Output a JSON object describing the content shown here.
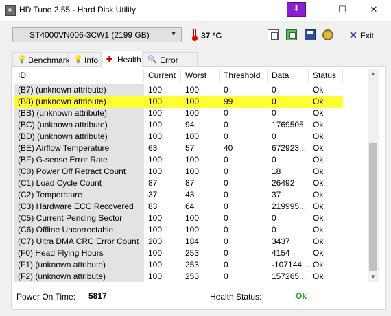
{
  "window": {
    "title": "HD Tune 2.55 - Hard Disk Utility",
    "minimize": "–",
    "maximize": "☐",
    "close": "✕"
  },
  "toolbar": {
    "drive": "ST4000VN006-3CW1 (2199 GB)",
    "temperature": "37 °C",
    "exit_label": "Exit",
    "icons": [
      "copy-icon",
      "copy-green-icon",
      "save-icon",
      "options-icon",
      "exit-icon"
    ]
  },
  "tabs": [
    {
      "label": "Benchmark",
      "icon": "benchmark-icon"
    },
    {
      "label": "Info",
      "icon": "info-icon"
    },
    {
      "label": "Health",
      "icon": "health-icon"
    },
    {
      "label": "Error Scan",
      "icon": "search-icon"
    }
  ],
  "active_tab": "Health",
  "colors": {
    "highlight": "#ffff33",
    "ok_status": "#1ea81e",
    "id_column_bg": "#e3e3e3"
  },
  "table": {
    "columns": [
      "ID",
      "Current",
      "Worst",
      "Threshold",
      "Data",
      "Status"
    ],
    "rows": [
      {
        "id": "(B7) (unknown attribute)",
        "current": "100",
        "worst": "100",
        "threshold": "0",
        "data": "0",
        "status": "Ok"
      },
      {
        "id": "(B8) (unknown attribute)",
        "current": "100",
        "worst": "100",
        "threshold": "99",
        "data": "0",
        "status": "Ok"
      },
      {
        "id": "(BB) (unknown attribute)",
        "current": "100",
        "worst": "100",
        "threshold": "0",
        "data": "0",
        "status": "Ok"
      },
      {
        "id": "(BC) (unknown attribute)",
        "current": "100",
        "worst": "94",
        "threshold": "0",
        "data": "1769505",
        "status": "Ok"
      },
      {
        "id": "(BD) (unknown attribute)",
        "current": "100",
        "worst": "100",
        "threshold": "0",
        "data": "0",
        "status": "Ok"
      },
      {
        "id": "(BE) Airflow Temperature",
        "current": "63",
        "worst": "57",
        "threshold": "40",
        "data": "672923...",
        "status": "Ok"
      },
      {
        "id": "(BF) G-sense Error Rate",
        "current": "100",
        "worst": "100",
        "threshold": "0",
        "data": "0",
        "status": "Ok"
      },
      {
        "id": "(C0) Power Off Retract Count",
        "current": "100",
        "worst": "100",
        "threshold": "0",
        "data": "18",
        "status": "Ok"
      },
      {
        "id": "(C1) Load Cycle Count",
        "current": "87",
        "worst": "87",
        "threshold": "0",
        "data": "26492",
        "status": "Ok"
      },
      {
        "id": "(C2) Temperature",
        "current": "37",
        "worst": "43",
        "threshold": "0",
        "data": "37",
        "status": "Ok"
      },
      {
        "id": "(C3) Hardware ECC Recovered",
        "current": "83",
        "worst": "64",
        "threshold": "0",
        "data": "219995...",
        "status": "Ok"
      },
      {
        "id": "(C5) Current Pending Sector",
        "current": "100",
        "worst": "100",
        "threshold": "0",
        "data": "0",
        "status": "Ok"
      },
      {
        "id": "(C6) Offline Uncorrectable",
        "current": "100",
        "worst": "100",
        "threshold": "0",
        "data": "0",
        "status": "Ok"
      },
      {
        "id": "(C7) Ultra DMA CRC Error Count",
        "current": "200",
        "worst": "184",
        "threshold": "0",
        "data": "3437",
        "status": "Ok"
      },
      {
        "id": "(F0) Head Flying Hours",
        "current": "100",
        "worst": "253",
        "threshold": "0",
        "data": "4154",
        "status": "Ok"
      },
      {
        "id": "(F1) (unknown attribute)",
        "current": "100",
        "worst": "253",
        "threshold": "0",
        "data": "-107144...",
        "status": "Ok"
      },
      {
        "id": "(F2) (unknown attribute)",
        "current": "100",
        "worst": "253",
        "threshold": "0",
        "data": "157265...",
        "status": "Ok"
      }
    ],
    "highlighted_row": 1
  },
  "status_bar": {
    "power_on_label": "Power On Time:",
    "power_on_value": "5817",
    "health_label": "Health Status:",
    "health_value": "Ok"
  }
}
